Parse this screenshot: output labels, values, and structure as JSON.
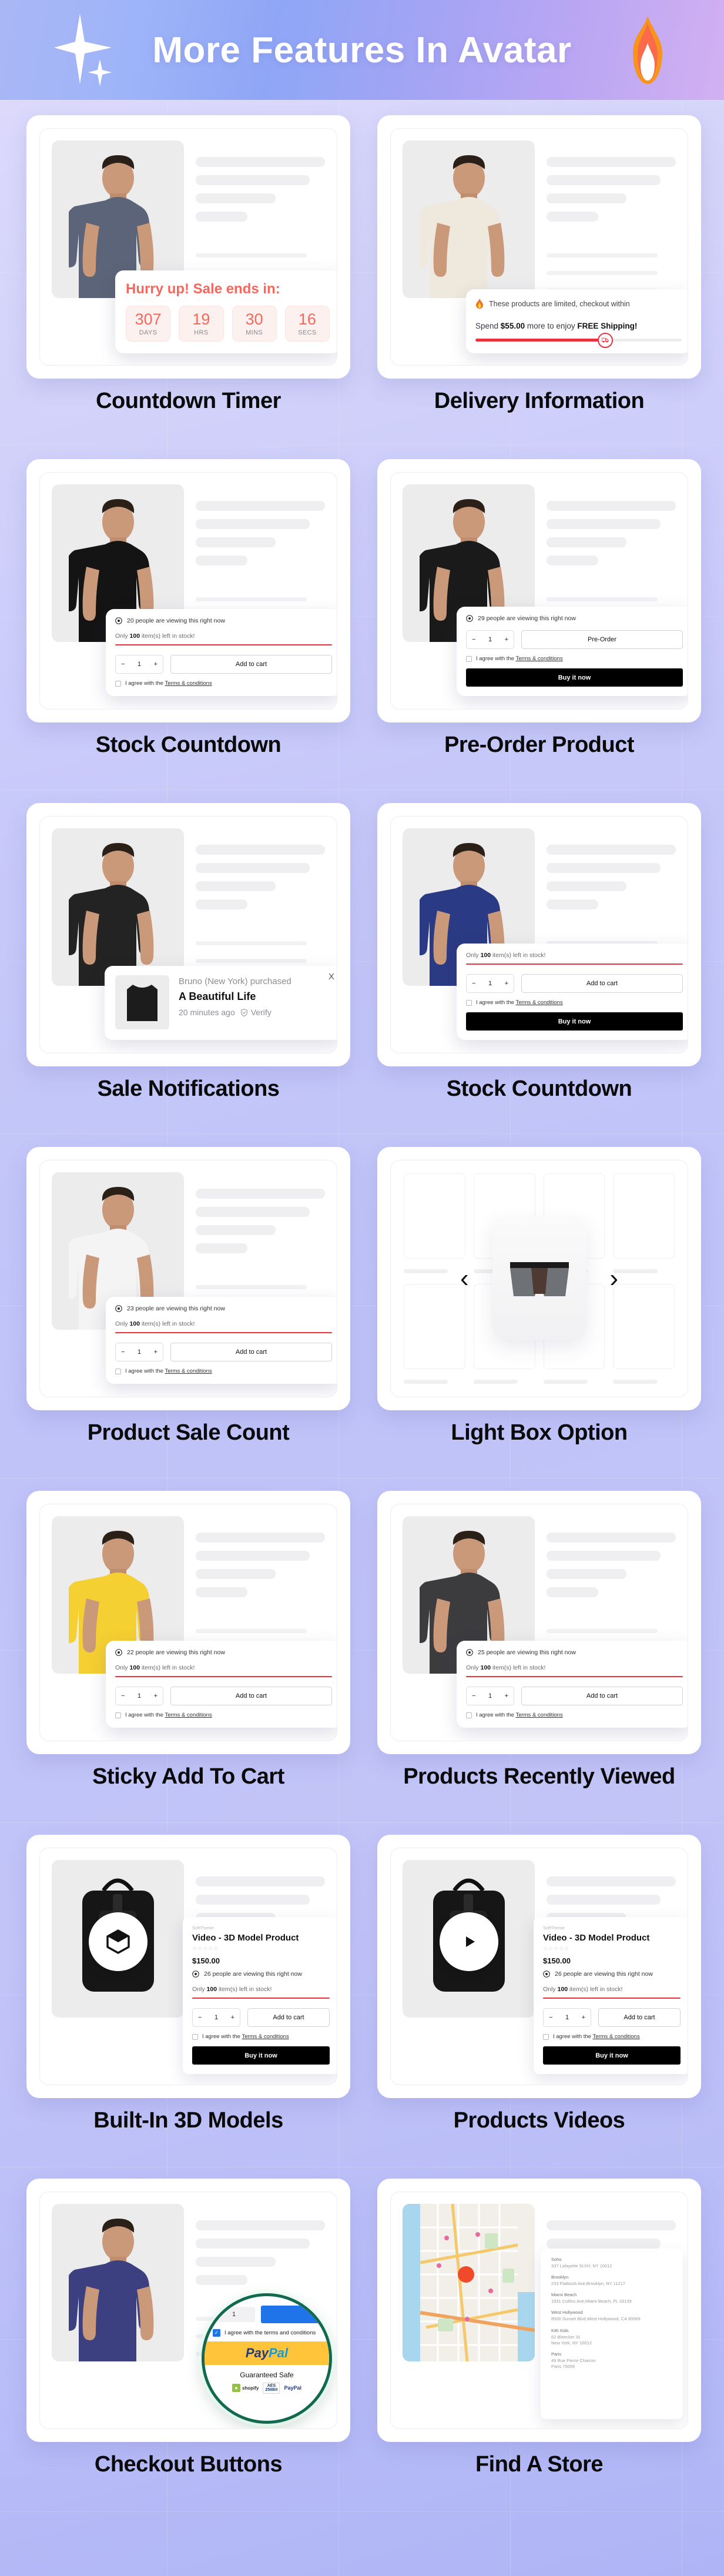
{
  "header": {
    "title": "More Features In Avatar",
    "left_icon": "sparkle-icon",
    "right_icon": "fire-icon"
  },
  "common": {
    "add_to_cart": "Add to cart",
    "buy_it_now": "Buy it now",
    "pre_order": "Pre-Order",
    "qty_value": "1",
    "qty_minus": "−",
    "qty_plus": "+",
    "agree_prefix": "I agree with the ",
    "terms_link": "Terms & conditions",
    "stock_prefix": "Only ",
    "stock_count": "100",
    "stock_suffix": " item(s) left in stock!",
    "viewing_suffix": " people are viewing this right now"
  },
  "cards": [
    {
      "label": "Countdown Timer",
      "type": "countdown",
      "countdown": {
        "title": "Hurry up! Sale ends in:",
        "units": [
          {
            "value": "307",
            "unit": "DAYS"
          },
          {
            "value": "19",
            "unit": "HRS"
          },
          {
            "value": "30",
            "unit": "MINS"
          },
          {
            "value": "16",
            "unit": "SECS"
          }
        ],
        "accent": "#f4685e"
      },
      "model_color": "#5b6478"
    },
    {
      "label": "Delivery Information",
      "type": "delivery",
      "delivery": {
        "limited_text": "These products are limited, checkout within",
        "spend_pre": "Spend ",
        "spend_amount": "$55.00",
        "spend_mid": " more to enjoy ",
        "spend_bold": "FREE Shipping!",
        "progress_percent": 63,
        "bar_color": "#e8333f"
      },
      "model_color": "#efe8dc"
    },
    {
      "label": "Stock Countdown",
      "type": "cart",
      "viewing_count": "20",
      "show_viewing": true,
      "show_stock": true,
      "show_buynow": false,
      "model_color": "#141414"
    },
    {
      "label": "Pre-Order Product",
      "type": "cart",
      "viewing_count": "29",
      "show_viewing": true,
      "show_stock": false,
      "show_buynow": true,
      "cta_label": "Pre-Order",
      "model_color": "#1a1a1a"
    },
    {
      "label": "Sale Notifications",
      "type": "notification",
      "notification": {
        "purchaser": "Bruno (New York) purchased",
        "product": "A Beautiful Life",
        "time": "20 minutes ago",
        "verify": "Verify",
        "close": "X"
      },
      "model_color": "#232323"
    },
    {
      "label": "Stock Countdown",
      "type": "cart",
      "viewing_count": "",
      "show_viewing": false,
      "show_stock": true,
      "show_buynow": true,
      "model_color": "#2b3a84"
    },
    {
      "label": "Product Sale Count",
      "type": "cart",
      "viewing_count": "23",
      "show_viewing": true,
      "show_stock": true,
      "show_buynow": false,
      "model_color": "#f4f4f4"
    },
    {
      "label": "Light Box Option",
      "type": "lightbox",
      "lightbox": {
        "prev": "‹",
        "next": "›"
      }
    },
    {
      "label": "Sticky Add To Cart",
      "type": "cart",
      "viewing_count": "22",
      "show_viewing": true,
      "show_stock": true,
      "show_buynow": false,
      "model_color": "#f5d032"
    },
    {
      "label": "Products Recently Viewed",
      "type": "cart",
      "viewing_count": "25",
      "show_viewing": true,
      "show_stock": true,
      "show_buynow": false,
      "model_color": "#3c3c3f"
    },
    {
      "label": "Built-In 3D Models",
      "type": "media",
      "media": {
        "badge": "cube-3d-icon",
        "vendor": "SoftTheme",
        "title": "Video - 3D Model Product",
        "stars": "☆☆☆☆☆",
        "price": "$150.00",
        "viewing_count": "26"
      }
    },
    {
      "label": "Products Videos",
      "type": "media",
      "media": {
        "badge": "play-icon",
        "vendor": "SoftTheme",
        "title": "Video - 3D Model Product",
        "stars": "☆☆☆☆☆",
        "price": "$150.00",
        "viewing_count": "26"
      }
    },
    {
      "label": "Checkout Buttons",
      "type": "checkout",
      "checkout": {
        "qty": "1",
        "terms": "I agree with the terms and conditions",
        "paypal_pay": "Pay",
        "paypal_pal": "Pal",
        "guaranteed": "Guaranteed Safe",
        "badge_shopify": "shopify",
        "badge_shopify_sub": "SECURE",
        "badge_aes": "AES",
        "badge_aes_sub": "256Bit",
        "badge_paypal": "PayPal"
      },
      "model_color": "#3c3f80"
    },
    {
      "label": "Find A Store",
      "type": "store",
      "stores": [
        {
          "name": "Soho",
          "address": "337 Lafayette St.NY, NY 10012"
        },
        {
          "name": "Brooklyn",
          "address": "233 Flatbush Ave,Brooklyn, NY 11217"
        },
        {
          "name": "Miami Beach",
          "address": "1931 Collins Ave,Miami Beach, FL 33139"
        },
        {
          "name": "West Hollywood",
          "address": "8500 Sunset Blvd,West Hollywood, CA 90069"
        },
        {
          "name": "Kith Kids",
          "address": "62 Bleecker St\nNew York, NY 10012"
        },
        {
          "name": "Paris",
          "address": "49 Rue Pierre Charron\nParis 75008"
        }
      ]
    }
  ],
  "colors": {
    "accent_red": "#e8333f",
    "accent_coral": "#f4685e",
    "paypal_yellow": "#ffc439",
    "paypal_blue": "#253b80",
    "paypal_cyan": "#179bd7",
    "checkout_green": "#13694f",
    "header_text": "#ffffff"
  }
}
